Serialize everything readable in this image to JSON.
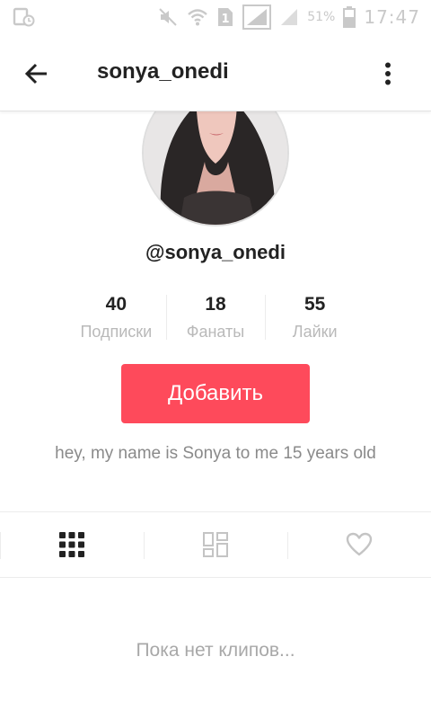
{
  "status_bar": {
    "battery_percent": "51%",
    "time": "17:47",
    "sim_badge": "1",
    "icons": [
      "screen-record-icon",
      "mute-icon",
      "wifi-icon",
      "sim1-icon",
      "signal-icon",
      "signal-icon",
      "battery-icon"
    ]
  },
  "header": {
    "title": "sonya_onedi",
    "back_icon": "arrow-left-icon",
    "more_icon": "more-vertical-icon"
  },
  "profile": {
    "username": "@sonya_onedi",
    "bio": "hey, my name is Sonya to me 15 years old",
    "add_button_label": "Добавить",
    "add_button_color": "#fe4a5b",
    "stats": [
      {
        "value": "40",
        "label": "Подписки"
      },
      {
        "value": "18",
        "label": "Фанаты"
      },
      {
        "value": "55",
        "label": "Лайки"
      }
    ]
  },
  "tabs": [
    {
      "icon": "grid-icon",
      "active": true
    },
    {
      "icon": "tiles-icon",
      "active": false
    },
    {
      "icon": "heart-icon",
      "active": false
    }
  ],
  "empty_state": "Пока нет клипов..."
}
